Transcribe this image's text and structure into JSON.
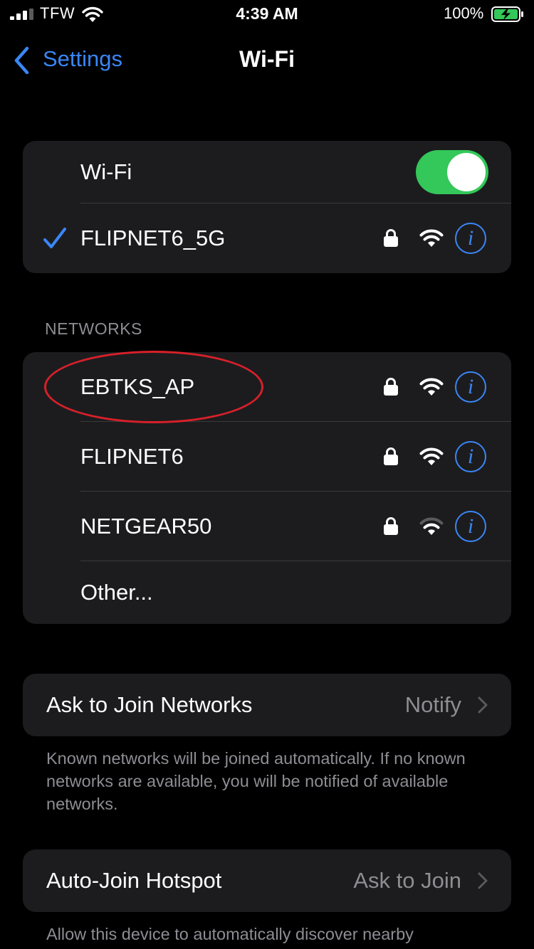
{
  "status_bar": {
    "carrier": "TFW",
    "time": "4:39 AM",
    "battery_percent": "100%",
    "signal_bars": 3,
    "signal_bars_total": 4,
    "charging": true
  },
  "nav": {
    "back_label": "Settings",
    "title": "Wi-Fi"
  },
  "wifi_section": {
    "toggle_label": "Wi-Fi",
    "toggle_on": true,
    "connected_network": {
      "name": "FLIPNET6_5G",
      "secured": true,
      "signal": "full",
      "icon": "checkmark-icon"
    }
  },
  "networks_section": {
    "header": "NETWORKS",
    "items": [
      {
        "name": "EBTKS_AP",
        "secured": true,
        "signal": "full"
      },
      {
        "name": "FLIPNET6",
        "secured": true,
        "signal": "full"
      },
      {
        "name": "NETGEAR50",
        "secured": true,
        "signal": "partial"
      }
    ],
    "other_label": "Other..."
  },
  "ask_to_join": {
    "label": "Ask to Join Networks",
    "value": "Notify",
    "footnote": "Known networks will be joined automatically. If no known networks are available, you will be notified of available networks."
  },
  "auto_join": {
    "label": "Auto-Join Hotspot",
    "value": "Ask to Join",
    "footnote": "Allow this device to automatically discover nearby"
  },
  "colors": {
    "accent": "#3a86f5",
    "toggle_on": "#34c759",
    "annotation": "#d8202a",
    "group_bg": "#1c1c1e"
  }
}
